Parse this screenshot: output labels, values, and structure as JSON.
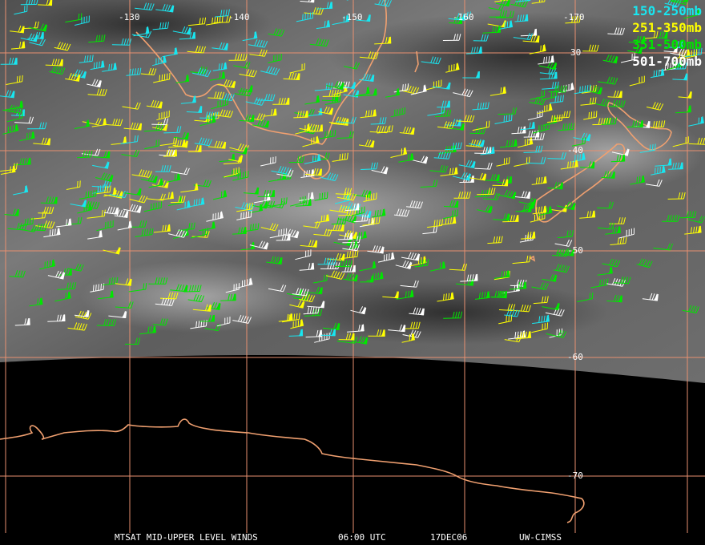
{
  "legend": [
    {
      "label": "150-250mb",
      "color": "#19e6f0"
    },
    {
      "label": "251-350mb",
      "color": "#ffff00"
    },
    {
      "label": "351-500mb",
      "color": "#00e600"
    },
    {
      "label": "501-700mb",
      "color": "#ffffff"
    }
  ],
  "longitude_labels": [
    "-130",
    "-140",
    "-150",
    "-160",
    "-170"
  ],
  "latitude_labels": [
    "30",
    "-40",
    "-50",
    "-60",
    "-70"
  ],
  "footer": {
    "product": "MTSAT MID-UPPER LEVEL WINDS",
    "time": "06:00 UTC",
    "date": "17DEC06",
    "source": "UW-CIMSS"
  },
  "colors": {
    "coastline": "#f0a070",
    "grid": "#e89070",
    "background_space": "#000000"
  }
}
